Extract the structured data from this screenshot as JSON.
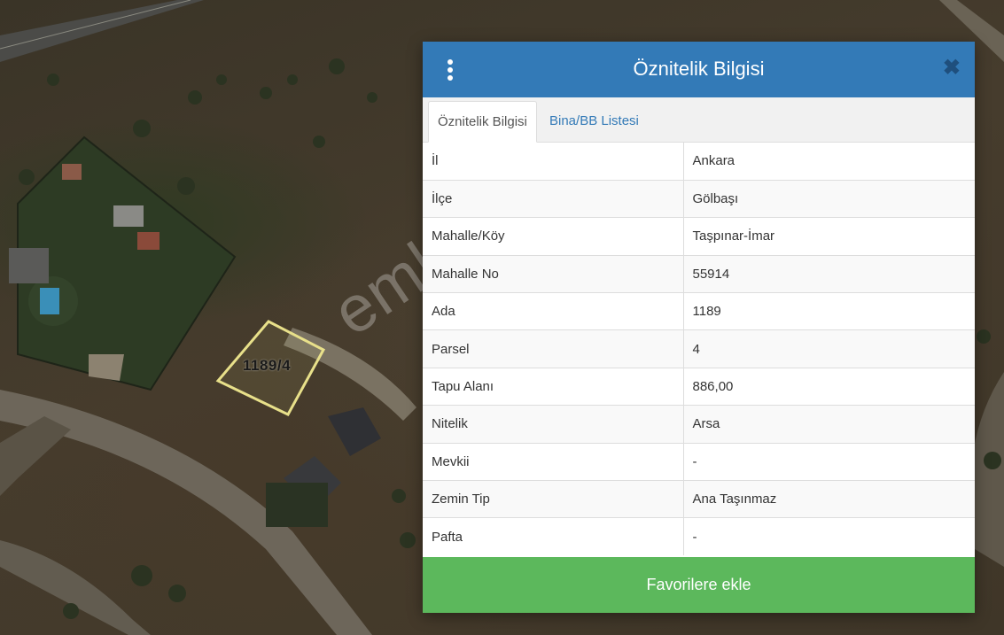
{
  "map": {
    "parcel_label": "1189/4",
    "watermark": "emlakjet.com"
  },
  "dialog": {
    "title": "Öznitelik Bilgisi",
    "close_symbol": "✖",
    "tabs": [
      "Öznitelik Bilgisi",
      "Bina/BB Listesi"
    ],
    "rows": [
      {
        "key": "İl",
        "value": "Ankara"
      },
      {
        "key": "İlçe",
        "value": "Gölbaşı"
      },
      {
        "key": "Mahalle/Köy",
        "value": "Taşpınar-İmar"
      },
      {
        "key": "Mahalle No",
        "value": "55914"
      },
      {
        "key": "Ada",
        "value": "1189"
      },
      {
        "key": "Parsel",
        "value": "4"
      },
      {
        "key": "Tapu Alanı",
        "value": "886,00"
      },
      {
        "key": "Nitelik",
        "value": "Arsa"
      },
      {
        "key": "Mevkii",
        "value": "-"
      },
      {
        "key": "Zemin Tip",
        "value": "Ana Taşınmaz"
      },
      {
        "key": "Pafta",
        "value": "-"
      }
    ],
    "favorite_button": "Favorilere ekle"
  },
  "colors": {
    "header": "#337ab7",
    "favorite": "#5cb85c",
    "parcel_outline": "#e8e08a"
  }
}
